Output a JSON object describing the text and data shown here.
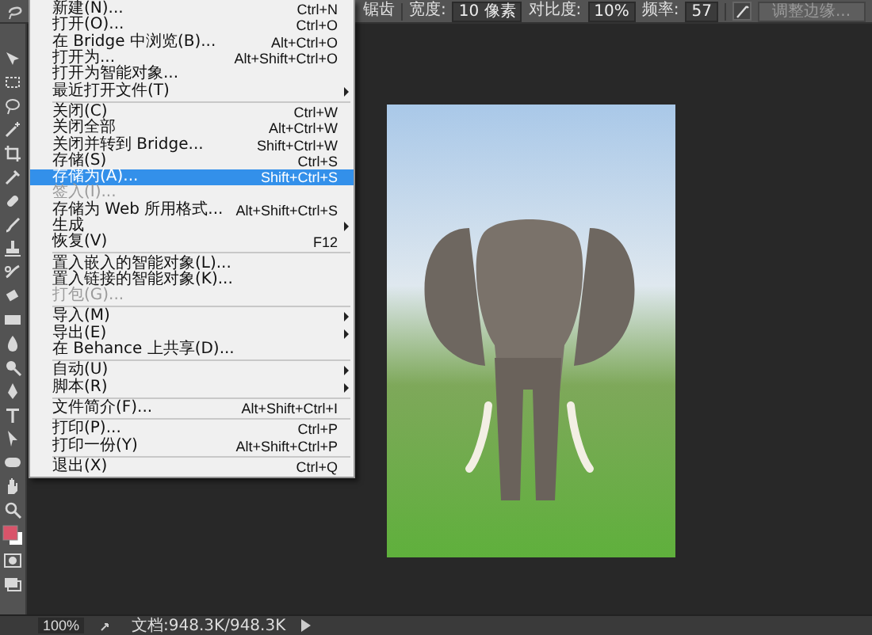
{
  "options_bar": {
    "cut_label": "锯齿",
    "fields": [
      {
        "label": "宽度:",
        "value": "10 像素"
      },
      {
        "label": "对比度:",
        "value": "10%"
      },
      {
        "label": "频率:",
        "value": "57"
      }
    ],
    "button": {
      "label": "调整边缘...",
      "disabled": true
    }
  },
  "file_menu": {
    "items": [
      {
        "kind": "item",
        "label": "新建(N)...",
        "shortcut": "Ctrl+N",
        "disabled": false,
        "selected": false,
        "submenu": false
      },
      {
        "kind": "item",
        "label": "打开(O)...",
        "shortcut": "Ctrl+O",
        "disabled": false,
        "selected": false,
        "submenu": false
      },
      {
        "kind": "item",
        "label": "在 Bridge 中浏览(B)...",
        "shortcut": "Alt+Ctrl+O",
        "disabled": false,
        "selected": false,
        "submenu": false
      },
      {
        "kind": "item",
        "label": "打开为...",
        "shortcut": "Alt+Shift+Ctrl+O",
        "disabled": false,
        "selected": false,
        "submenu": false
      },
      {
        "kind": "item",
        "label": "打开为智能对象...",
        "disabled": false,
        "selected": false,
        "submenu": false
      },
      {
        "kind": "item",
        "label": "最近打开文件(T)",
        "disabled": false,
        "selected": false,
        "submenu": true
      },
      {
        "kind": "separator"
      },
      {
        "kind": "item",
        "label": "关闭(C)",
        "shortcut": "Ctrl+W",
        "disabled": false,
        "selected": false,
        "submenu": false
      },
      {
        "kind": "item",
        "label": "关闭全部",
        "shortcut": "Alt+Ctrl+W",
        "disabled": false,
        "selected": false,
        "submenu": false
      },
      {
        "kind": "item",
        "label": "关闭并转到 Bridge...",
        "shortcut": "Shift+Ctrl+W",
        "disabled": false,
        "selected": false,
        "submenu": false
      },
      {
        "kind": "item",
        "label": "存储(S)",
        "shortcut": "Ctrl+S",
        "disabled": false,
        "selected": false,
        "submenu": false
      },
      {
        "kind": "item",
        "label": "存储为(A)...",
        "shortcut": "Shift+Ctrl+S",
        "disabled": false,
        "selected": true,
        "submenu": false
      },
      {
        "kind": "item",
        "label": "签入(I)...",
        "disabled": true,
        "selected": false,
        "submenu": false
      },
      {
        "kind": "item",
        "label": "存储为 Web 所用格式...",
        "shortcut": "Alt+Shift+Ctrl+S",
        "disabled": false,
        "selected": false,
        "submenu": false
      },
      {
        "kind": "item",
        "label": "生成",
        "disabled": false,
        "selected": false,
        "submenu": true
      },
      {
        "kind": "item",
        "label": "恢复(V)",
        "shortcut": "F12",
        "disabled": false,
        "selected": false,
        "submenu": false
      },
      {
        "kind": "separator"
      },
      {
        "kind": "item",
        "label": "置入嵌入的智能对象(L)...",
        "disabled": false,
        "selected": false,
        "submenu": false
      },
      {
        "kind": "item",
        "label": "置入链接的智能对象(K)...",
        "disabled": false,
        "selected": false,
        "submenu": false
      },
      {
        "kind": "item",
        "label": "打包(G)...",
        "disabled": true,
        "selected": false,
        "submenu": false
      },
      {
        "kind": "separator"
      },
      {
        "kind": "item",
        "label": "导入(M)",
        "disabled": false,
        "selected": false,
        "submenu": true
      },
      {
        "kind": "item",
        "label": "导出(E)",
        "disabled": false,
        "selected": false,
        "submenu": true
      },
      {
        "kind": "item",
        "label": "在 Behance 上共享(D)...",
        "disabled": false,
        "selected": false,
        "submenu": false
      },
      {
        "kind": "separator"
      },
      {
        "kind": "item",
        "label": "自动(U)",
        "disabled": false,
        "selected": false,
        "submenu": true
      },
      {
        "kind": "item",
        "label": "脚本(R)",
        "disabled": false,
        "selected": false,
        "submenu": true
      },
      {
        "kind": "separator"
      },
      {
        "kind": "item",
        "label": "文件简介(F)...",
        "shortcut": "Alt+Shift+Ctrl+I",
        "disabled": false,
        "selected": false,
        "submenu": false
      },
      {
        "kind": "separator"
      },
      {
        "kind": "item",
        "label": "打印(P)...",
        "shortcut": "Ctrl+P",
        "disabled": false,
        "selected": false,
        "submenu": false
      },
      {
        "kind": "item",
        "label": "打印一份(Y)",
        "shortcut": "Alt+Shift+Ctrl+P",
        "disabled": false,
        "selected": false,
        "submenu": false
      },
      {
        "kind": "separator"
      },
      {
        "kind": "item",
        "label": "退出(X)",
        "shortcut": "Ctrl+Q",
        "disabled": false,
        "selected": false,
        "submenu": false
      }
    ]
  },
  "status_bar": {
    "zoom": "100%",
    "document": "文档:948.3K/948.3K"
  }
}
